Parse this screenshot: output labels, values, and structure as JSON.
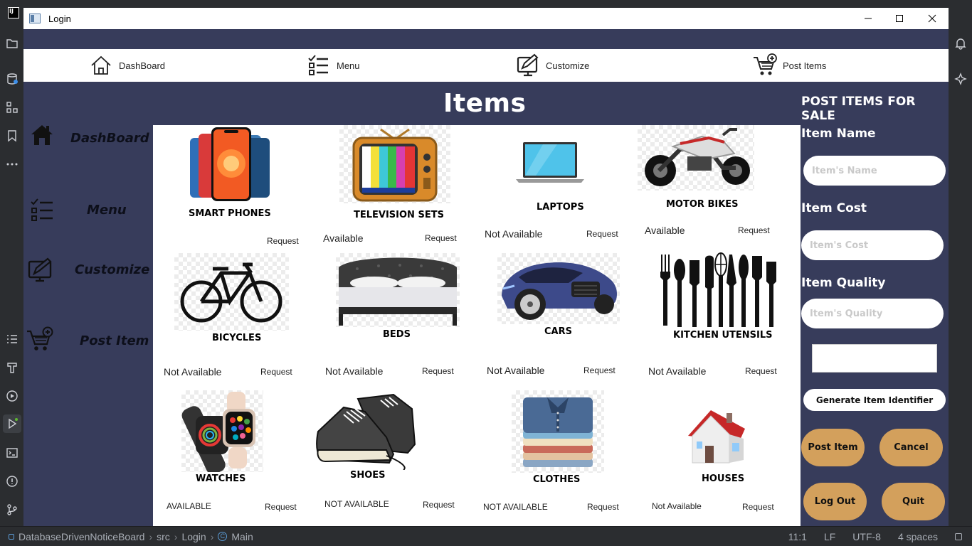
{
  "ide": {
    "status": {
      "project": "DatabaseDrivenNoticeBoard",
      "path1": "src",
      "path2": "Login",
      "path3": "Main",
      "position": "11:1",
      "line_sep": "LF",
      "encoding": "UTF-8",
      "indent": "4 spaces"
    }
  },
  "window": {
    "title": "Login"
  },
  "topnav": {
    "items": [
      {
        "label": "DashBoard",
        "icon": "home-icon"
      },
      {
        "label": "Menu",
        "icon": "checklist-icon"
      },
      {
        "label": "Customize",
        "icon": "edit-monitor-icon"
      },
      {
        "label": "Post Items",
        "icon": "cart-plus-icon"
      }
    ]
  },
  "page": {
    "title": "Items"
  },
  "sidebar": {
    "items": [
      {
        "label": "DashBoard",
        "icon": "home-icon"
      },
      {
        "label": "Menu",
        "icon": "checklist-icon"
      },
      {
        "label": "Customize",
        "icon": "edit-monitor-icon"
      },
      {
        "label": "Post Item",
        "icon": "cart-plus-icon"
      }
    ]
  },
  "items": [
    {
      "name": "SMART PHONES",
      "status": "",
      "request": "Request"
    },
    {
      "name": "TELEVISION SETS",
      "status": "Available",
      "request": "Request"
    },
    {
      "name": "LAPTOPS",
      "status": "Not Available",
      "request": "Request"
    },
    {
      "name": "MOTOR BIKES",
      "status": "Available",
      "request": "Request"
    },
    {
      "name": "BICYCLES",
      "status": "Not Available",
      "request": "Request"
    },
    {
      "name": "BEDS",
      "status": "Not Available",
      "request": "Request"
    },
    {
      "name": "CARS",
      "status": "Not Available",
      "request": "Request"
    },
    {
      "name": "KITCHEN UTENSILS",
      "status": "Not Available",
      "request": "Request"
    },
    {
      "name": "WATCHES",
      "status": "AVAILABLE",
      "request": "Request"
    },
    {
      "name": "SHOES",
      "status": "NOT AVAILABLE",
      "request": "Request"
    },
    {
      "name": "CLOTHES",
      "status": "NOT AVAILABLE",
      "request": "Request"
    },
    {
      "name": "HOUSES",
      "status": "Not Available",
      "request": "Request"
    }
  ],
  "form": {
    "heading": "POST ITEMS FOR SALE",
    "name_label": "Item Name",
    "name_placeholder": "Item's Name",
    "cost_label": "Item Cost",
    "cost_placeholder": "Item's Cost",
    "quality_label": "Item Quality",
    "quality_placeholder": "Item's Quality",
    "identifier_value": "",
    "generate_label": "Generate Item Identifier",
    "post_label": "Post Item",
    "cancel_label": "Cancel",
    "logout_label": "Log Out",
    "quit_label": "Quit"
  },
  "colors": {
    "window_bg": "#373c5b",
    "panel_bg": "#ffffff",
    "button_gold": "#d3a05c",
    "ide_bg": "#2b2d30"
  }
}
